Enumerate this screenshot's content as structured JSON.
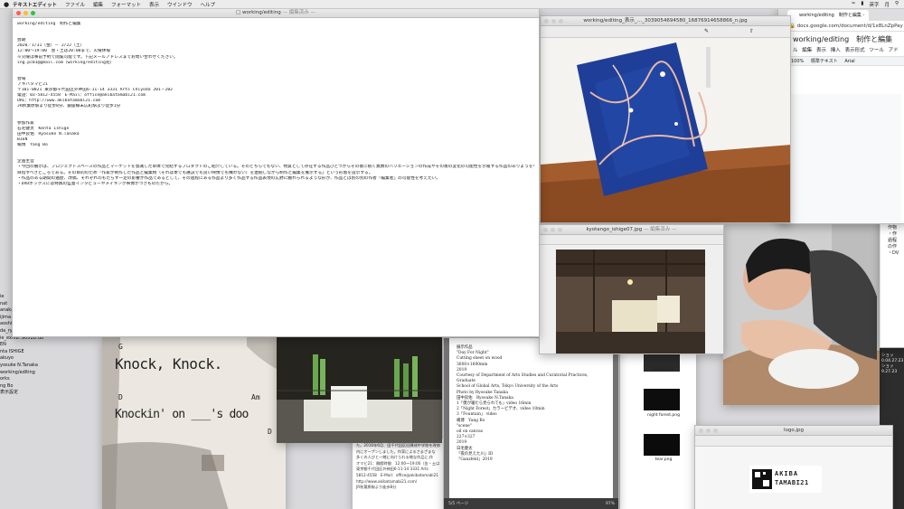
{
  "menubar": {
    "app": "テキストエディット",
    "items": [
      "ファイル",
      "編集",
      "フォーマット",
      "表示",
      "ウインドウ",
      "ヘルプ"
    ],
    "status": [
      "英字",
      "月"
    ]
  },
  "desktop_list": [
    "ie",
    "nat",
    "anaka",
    "ijima",
    "aoshi",
    "da_ryou.pdf",
    "ie_exhib..9051D.do",
    "EN",
    "nta ISHIGE",
    "akuyo",
    "yosuke N.Tanaka",
    "working/editing",
    "orks",
    "ng Bo",
    "表示設定"
  ],
  "editor": {
    "title": "working/editing",
    "status": "— 編集済み —",
    "lines": [
      "working/editing　制作と編集",
      "",
      "",
      "会期",
      "2020／1/31（金）－ 2/22（土）",
      "12:00～19:00　会・土は20:00まで、火曜休場",
      "※火曜は事前予約で閲覧可能です。下記メールアドレスまでお問い合わせください。",
      "ing.pc01@gmail.com（working/editing宛）",
      "",
      "",
      "会場",
      "アキバタマビ21",
      "〒101-0021 東京都千代田区外神田6-11-14 3331 Arts Chiyoda 201・202",
      "電話：03-5812-4558　E-Mail：office@akibatamabi21.com",
      "URL：http://www.akibatamabi21.com",
      "JR秋葉原駅より徒歩8分、銀座線末広町駅より徒歩1分",
      "",
      "",
      "参加作家",
      "石毛健太　Kenta Ishige",
      "田中良佑　Ryosuke N.Tanaka",
      "BIEN",
      "楊博　Yang Bo",
      "",
      "",
      "企画主旨",
      "・今回の展示は、プロジェクトスペースの作品とマーケットを意識した単体で完結するプロダクトのご紹介している。そのどちらでもない、物質として存在する作品ひとつからその後に続く無数のバリエーションの作成やその後の変化の可能性を示唆する作品のありようを考え直すことが本展覧会の",
      "目指すべきところである。その目的のため「作家が制作した作品と編集物（それは本でも展説でも良い映像でも構わない）を連続しながら制作と編集を展示する」という形態を提示する。",
      "・作品のある期間の遍歴、改稿、それぞれのもたらす一定の影響が作品であるとして、その過程にある作品より多く作品する作品表現の広野に触れられるような形が、作品とは別の別の作者「編集者」の可能性を考えたい。",
      "・DVDボックスには特典の監督インタビューやメイキング映像がつきものだから。",
      ""
    ]
  },
  "photo_top": {
    "title": "working/editing_表示_…_3039054694580_16876914658866_n.jpg"
  },
  "browser": {
    "tab": "working/editing　制作と編集 -",
    "url": "docs.google.com/document/d/1x8LnZpPay",
    "doc_title": "working/editing　制作と編集",
    "menus": [
      "ル",
      "編集",
      "表示",
      "挿入",
      "表示形式",
      "ツール",
      "アド"
    ],
    "tools": [
      "100%",
      "標準テキスト",
      "Arial"
    ]
  },
  "right_doc": [
    "タイ",
    "「wo",
    "会期",
    "1/22(",
    "1/31(",
    "2/23(",
    "レセ",
    "トー",
    "参加",
    "石毛",
    "田中",
    "BIEN",
    "楊博",
    "フラ",
    "山田",
    "主旨",
    "・今",
    "クト",
    "続く",
    "直す",
    "編集",
    "作物",
    "・作",
    "過程",
    "の作",
    "・DV"
  ],
  "kyoto": {
    "title": "kyotango_ishige07.jpg",
    "status": "— 編集済み —"
  },
  "knock": {
    "g": "G",
    "line1": "Knock, Knock.",
    "d": "D",
    "am": "Am",
    "line2": "Knockin' on ___'s doo",
    "d2": "D"
  },
  "pdf": {
    "lines": [
      "展示作品",
      "\"Day For Night\"",
      "Cutting sheet on wood",
      "3600×1600mm",
      "2019",
      "",
      "Courtesy of Department of Arts Studies and Curatorial Practices, Graduate",
      "School of Global Arts, Tokyo University of the Arts",
      "Photo by Ryosuke Tanaka",
      "",
      "田中良佑　Ryosuke N.Tanaka",
      "1「僕が寝たら見られても」video 16min",
      "2「Night Forest」カラービデオ、video 10min",
      "3「Fountain」 video",
      "",
      "楊博　Yang Bo",
      "\"scene\"",
      "oil on canvas",
      "227×327",
      "2019",
      "",
      "日毛健太",
      "「夜の見えた川」ID",
      "「Ganzfeld」2019"
    ],
    "page_label": "5/5 ページ",
    "zoom": "97%"
  },
  "jpdoc": {
    "lines": [
      "た。2016年6月、田千代田区旧錬成中学校を改修",
      "内にオープンしました。作家によるさまざまな",
      "多くの人びと一緒に向けられる様な作品に,作",
      "",
      "オマビ21：開館時間　12:00～19:00（金・土は",
      "東京都千代田区外神田6-11-14 3331 Arts",
      "5812-4558　E-Mail：office@akibatamabi21",
      "http://www.akibatamabi21.com/",
      "JR秋葉原駅より徒歩8分"
    ]
  },
  "thumbs": [
    "tear2.png",
    "night forest.png",
    "tear.png"
  ],
  "logo": {
    "title": "logo.jpg",
    "line1": "AKIBA",
    "line2": "TAMABI21"
  },
  "rclock": [
    "ショッ",
    "0.04.27.23",
    "",
    "ショッ",
    "9.27.23"
  ]
}
